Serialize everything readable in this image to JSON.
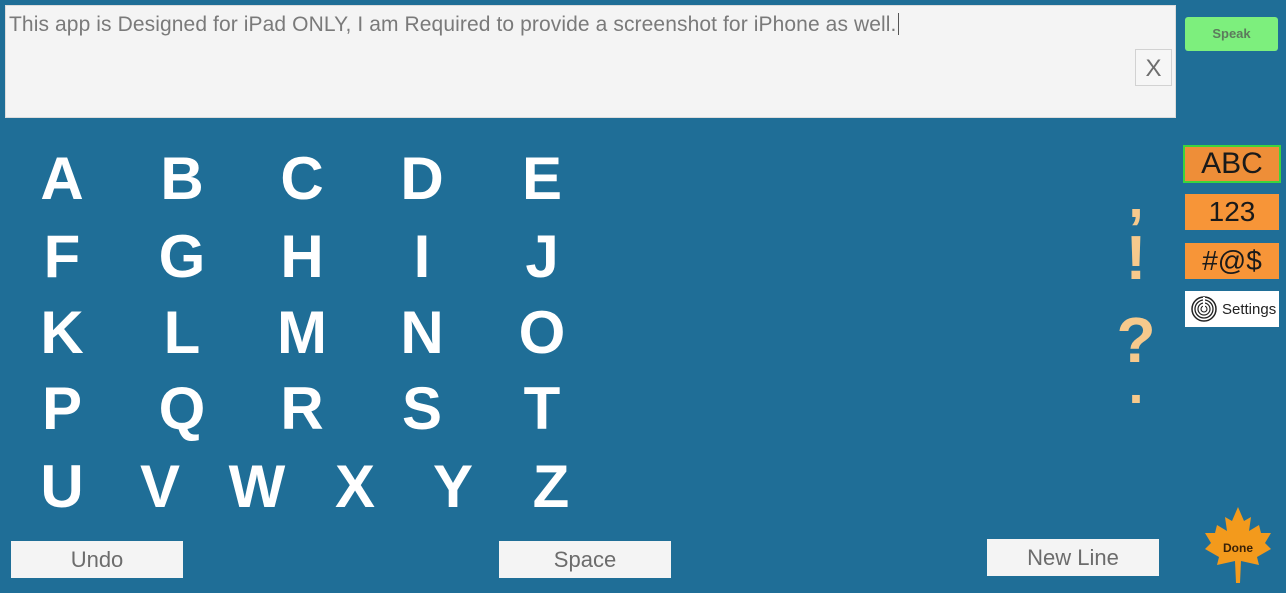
{
  "input": {
    "text": "This app is Designed for iPad ONLY, I am Required to provide a screenshot for iPhone as well.",
    "clear_label": "X"
  },
  "speak_label": "Speak",
  "letters": [
    "A",
    "B",
    "C",
    "D",
    "E",
    "F",
    "G",
    "H",
    "I",
    "J",
    "K",
    "L",
    "M",
    "N",
    "O",
    "P",
    "Q",
    "R",
    "S",
    "T",
    "U",
    "V",
    "W",
    "X",
    "Y",
    "Z"
  ],
  "punctuation": [
    ",",
    "!",
    "?",
    "."
  ],
  "modes": {
    "abc": "ABC",
    "num": "123",
    "sym": "#@$",
    "settings": "Settings"
  },
  "buttons": {
    "undo": "Undo",
    "space": "Space",
    "new_line": "New Line",
    "done": "Done"
  },
  "colors": {
    "background": "#1f6e97",
    "speak": "#7def7d",
    "mode": "#f79538",
    "active_border": "#3cd43c",
    "punctuation": "#f6c98c",
    "done_leaf": "#f39a1c"
  }
}
